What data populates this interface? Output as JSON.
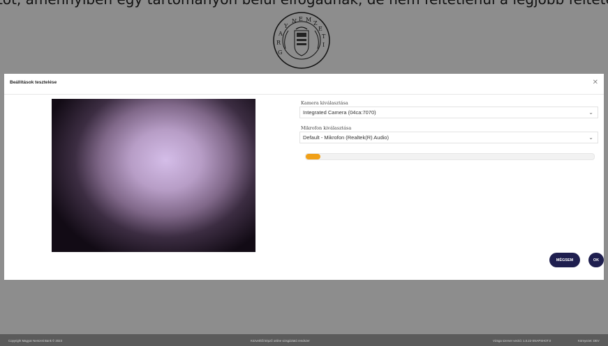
{
  "banner": {
    "text": "tot, amennyiben egy tartományon belül elfogadnak, de nem feltétlenül a legjobb feltételekkel és a",
    "seal_text": "MAGYAR NEMZETI BANK"
  },
  "modal": {
    "title": "Beállítások tesztelése",
    "camera_label": "Kamera kiválasztása",
    "camera_value": "Integrated Camera (04ca:7070)",
    "mic_label": "Mikrofon kiválasztása",
    "mic_value": "Default - Mikrofon (Realtek(R) Audio)",
    "mic_level": 0.05,
    "cancel_label": "MÉGSEM",
    "ok_label": "OK"
  },
  "footer": {
    "copyright": "Copyright Magyar Nemzeti Bank © 2023",
    "system": "Közvetítői képző online vizsgáztató rendszer",
    "version": "Vizsga szerver verzió: 1.0.22-SNAPSHOT.0",
    "env": "Környezet: DEV"
  },
  "colors": {
    "accent_button": "#1f1f4f",
    "level_fill": "#f0a018"
  }
}
